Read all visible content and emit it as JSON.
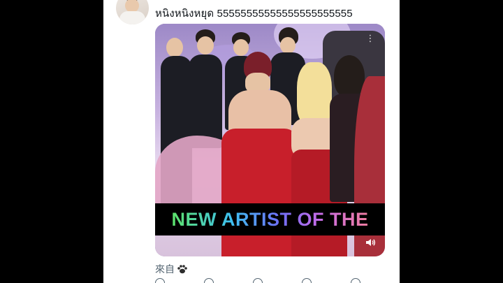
{
  "post": {
    "handle_partial": "•• ••",
    "text": "หนิงหนิงหยุด 55555555555555555555555",
    "media": {
      "caption": "NEW ARTIST OF THE",
      "menu_icon": "more-icon",
      "volume_icon": "volume-icon"
    },
    "source_label": "來自",
    "source_icon": "paw-icon"
  },
  "colors": {
    "page_bg": "#000000",
    "card_bg": "#ffffff",
    "text_primary": "#0f1419",
    "text_secondary": "#536471"
  }
}
